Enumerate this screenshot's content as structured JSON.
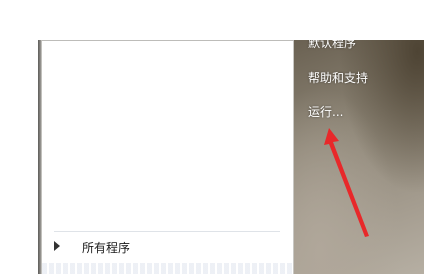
{
  "start_menu": {
    "left_pane": {
      "all_programs_label": "所有程序"
    },
    "right_pane": {
      "items": [
        {
          "label": "默认程序"
        },
        {
          "label": "帮助和支持"
        },
        {
          "label": "运行..."
        }
      ]
    }
  },
  "annotation": {
    "arrow_color": "#e8282a",
    "points_to": "运行..."
  }
}
